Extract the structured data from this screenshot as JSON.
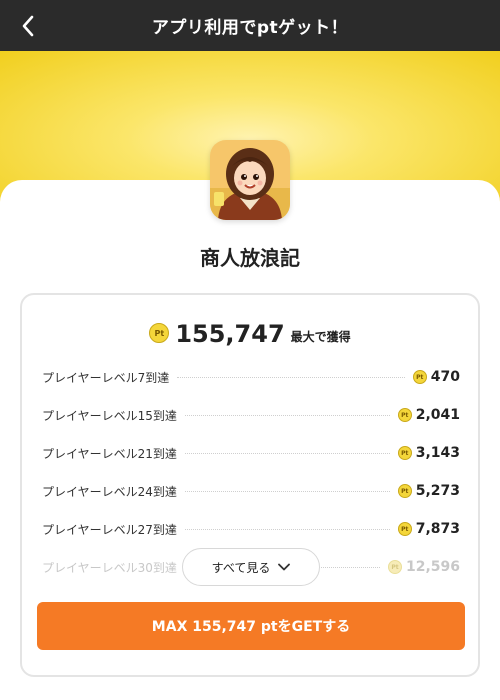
{
  "header": {
    "title": "アプリ利用でptゲット！"
  },
  "app": {
    "name": "商人放浪記"
  },
  "reward": {
    "total": "155,747",
    "suffix": "最大で獲得",
    "coin_label": "Pt"
  },
  "levels": [
    {
      "label": "プレイヤーレベル7到達",
      "points": "470"
    },
    {
      "label": "プレイヤーレベル15到達",
      "points": "2,041"
    },
    {
      "label": "プレイヤーレベル21到達",
      "points": "3,143"
    },
    {
      "label": "プレイヤーレベル24到達",
      "points": "5,273"
    },
    {
      "label": "プレイヤーレベル27到達",
      "points": "7,873"
    },
    {
      "label": "プレイヤーレベル30到達",
      "points": "12,596"
    }
  ],
  "see_all": {
    "label": "すべて見る"
  },
  "cta": {
    "label": "MAX 155,747 ptをGETする"
  },
  "colors": {
    "header": "#2b2b2b",
    "hero": "#f1cf1e",
    "cta": "#f57a25",
    "coin": "#f4d63a"
  }
}
